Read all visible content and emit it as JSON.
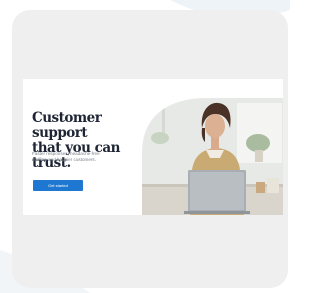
{
  "hero": {
    "headline_line1": "Customer support",
    "headline_line2": "that you can trust.",
    "subtext_line1": "Faster responses, headache-free",
    "subtext_line2": "staffing and happier customers.",
    "cta_label": "Get started"
  },
  "colors": {
    "card_background": "#efefef",
    "headline": "#1d2433",
    "cta_background": "#1e78d1",
    "subtext": "#7a808a"
  },
  "icons": {
    "laptop": "laptop-icon"
  }
}
